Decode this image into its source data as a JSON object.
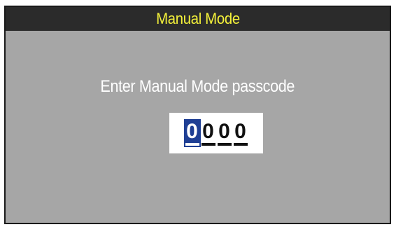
{
  "header": {
    "title": "Manual Mode"
  },
  "main": {
    "prompt": "Enter Manual Mode passcode",
    "passcode_digits": [
      "0",
      "0",
      "0",
      "0"
    ],
    "active_digit_index": 0
  },
  "colors": {
    "title_text": "#f5f23a",
    "title_bar": "#2b2b2b",
    "background": "#a6a6a6",
    "active_digit": "#1f3f94"
  }
}
